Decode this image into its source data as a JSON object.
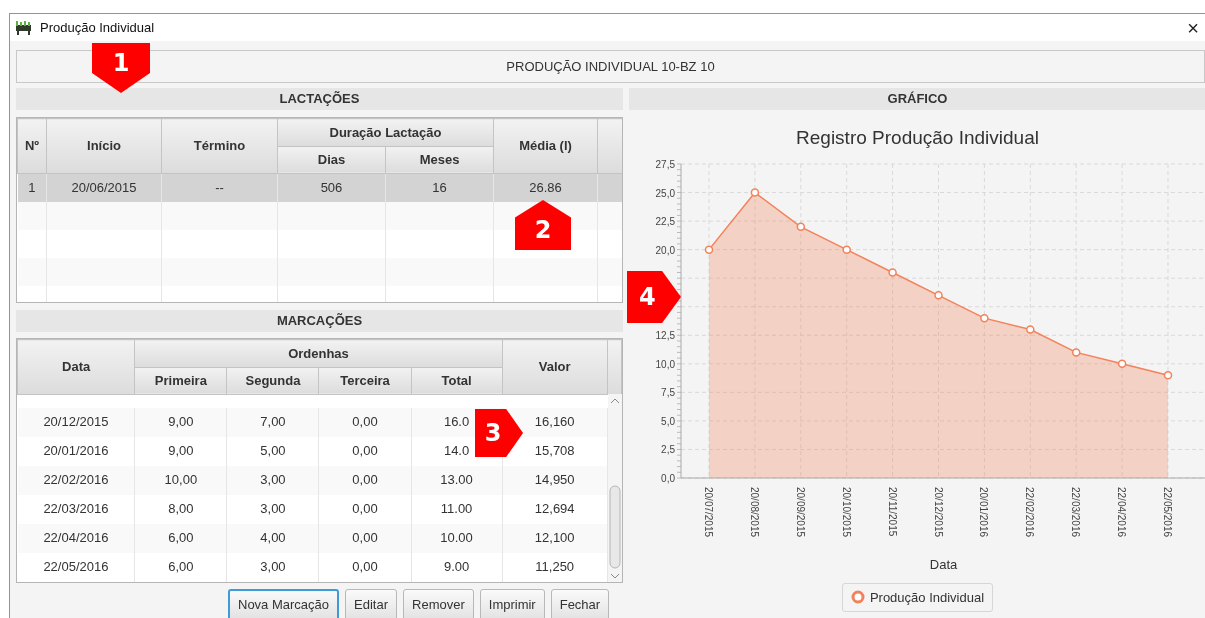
{
  "window": {
    "title": "Produção Individual",
    "close": "×"
  },
  "header": "PRODUÇÃO INDIVIDUAL 10-BZ 10",
  "lactacoes": {
    "title": "LACTAÇÕES",
    "callout": {
      "label": "1",
      "kind": "down"
    },
    "columns": [
      {
        "label": "Nº"
      },
      {
        "label": "Início"
      },
      {
        "label": "Término"
      },
      {
        "label": "Duração Lactação",
        "colspan": 2,
        "children": [
          {
            "label": "Dias"
          },
          {
            "label": "Meses"
          }
        ]
      },
      {
        "label": "Média (l)"
      }
    ],
    "rows": [
      {
        "selected": true,
        "cells": [
          "1",
          "20/06/2015",
          "--",
          "506",
          "16",
          "26.86"
        ]
      }
    ],
    "cell_callout": {
      "label": "2",
      "kind": "up"
    }
  },
  "marcacoes": {
    "title": "MARCAÇÕES",
    "columns": [
      {
        "label": "Data"
      },
      {
        "label": "Ordenhas",
        "colspan": 4,
        "children": [
          {
            "label": "Primeira"
          },
          {
            "label": "Segunda"
          },
          {
            "label": "Terceira"
          },
          {
            "label": "Total"
          }
        ]
      },
      {
        "label": "Valor"
      }
    ],
    "rows": [
      {
        "selected": false,
        "cells": [
          "20/12/2015",
          "9,00",
          "7,00",
          "0,00",
          "16.0",
          "16,160"
        ]
      },
      {
        "selected": false,
        "cells": [
          "20/01/2016",
          "9,00",
          "5,00",
          "0,00",
          "14.0",
          "15,708"
        ]
      },
      {
        "selected": false,
        "cells": [
          "22/02/2016",
          "10,00",
          "3,00",
          "0,00",
          "13.00",
          "14,950"
        ]
      },
      {
        "selected": false,
        "cells": [
          "22/03/2016",
          "8,00",
          "3,00",
          "0,00",
          "11.00",
          "12,694"
        ]
      },
      {
        "selected": false,
        "cells": [
          "22/04/2016",
          "6,00",
          "4,00",
          "0,00",
          "10.00",
          "12,100"
        ]
      },
      {
        "selected": false,
        "cells": [
          "22/05/2016",
          "6,00",
          "3,00",
          "0,00",
          "9.00",
          "11,250"
        ]
      }
    ],
    "callout": {
      "label": "3",
      "kind": "right"
    },
    "buttons": [
      {
        "label": "Nova Marcação",
        "focused": true
      },
      {
        "label": "Editar",
        "focused": false
      },
      {
        "label": "Remover",
        "focused": false
      },
      {
        "label": "Imprimir",
        "focused": false
      },
      {
        "label": "Fechar",
        "focused": false
      }
    ]
  },
  "grafico": {
    "title": "GRÁFICO",
    "callout": {
      "label": "4",
      "kind": "right"
    },
    "chart_data": {
      "type": "area",
      "grid": true,
      "title": "Registro Produção Individual",
      "xlabel": "Data",
      "categories": [
        "20/07/2015",
        "20/08/2015",
        "20/09/2015",
        "20/10/2015",
        "20/11/2015",
        "20/12/2015",
        "20/01/2016",
        "22/02/2016",
        "22/03/2016",
        "22/04/2016",
        "22/05/2016"
      ],
      "series": [
        {
          "name": "Produção Individual",
          "color": "#f3825a",
          "values": [
            20,
            25,
            22,
            20,
            18,
            16,
            14,
            13,
            11,
            10,
            9
          ]
        }
      ],
      "ylim": [
        0,
        27.5
      ],
      "yticks": [
        {
          "value": 0,
          "label": "0,0"
        },
        {
          "value": 2.5,
          "label": "2,5"
        },
        {
          "value": 5,
          "label": "5,0"
        },
        {
          "value": 7.5,
          "label": "7,5"
        },
        {
          "value": 10,
          "label": "10,0"
        },
        {
          "value": 12.5,
          "label": "12,5"
        },
        {
          "value": 20,
          "label": "20,0"
        },
        {
          "value": 22.5,
          "label": "22,5"
        },
        {
          "value": 25,
          "label": "25,0"
        },
        {
          "value": 27.5,
          "label": "27,5"
        }
      ]
    }
  }
}
